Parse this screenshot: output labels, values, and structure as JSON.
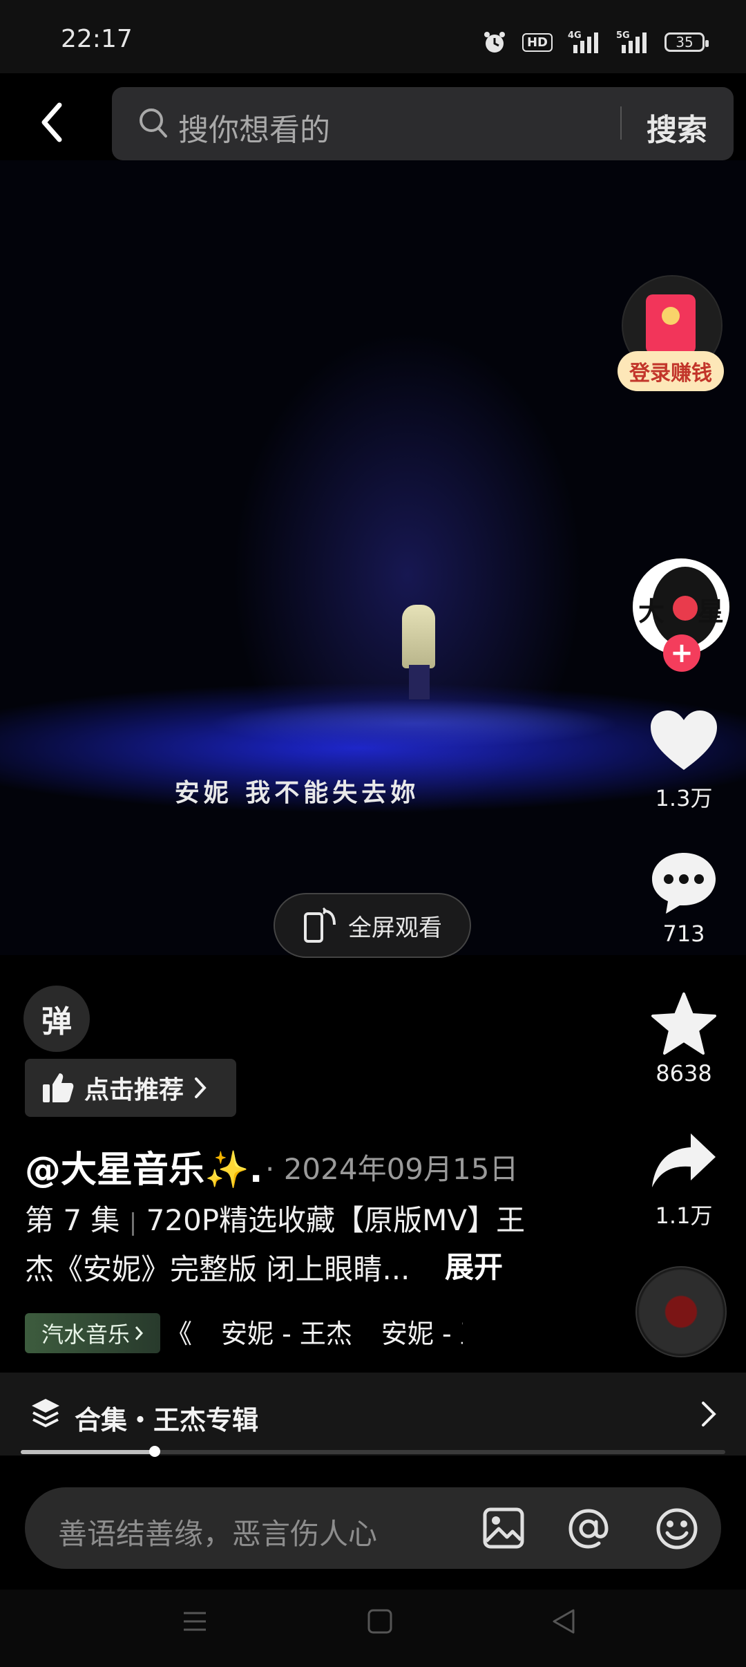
{
  "status_bar": {
    "time": "22:17",
    "battery": "35",
    "network_labels": [
      "HD",
      "4G",
      "5G"
    ]
  },
  "search": {
    "placeholder": "搜你想看的",
    "button": "搜索"
  },
  "video": {
    "subtitle": "安妮  我不能失去妳",
    "fullscreen_label": "全屏观看"
  },
  "right_rail": {
    "login_earn": "登录赚钱",
    "avatar_text": [
      "大",
      "星"
    ],
    "likes": "1.3万",
    "comments": "713",
    "favorites": "8638",
    "shares": "1.1万"
  },
  "info": {
    "danmu_label": "弹",
    "recommend_label": "点击推荐",
    "author": "@大星音乐✨.",
    "date": "· 2024年09月15日",
    "episode": "第 7 集",
    "desc_line1": "720P精选收藏【原版MV】王",
    "desc_line2": "杰《安妮》完整版 闭上眼睛...",
    "expand": "展开",
    "music_tag": "汽水音乐",
    "music_marquee": [
      "《",
      "安妮 - 王杰",
      "安妮 - 王"
    ]
  },
  "collection": {
    "label": "合集・王杰专辑",
    "progress": 0.19
  },
  "comment": {
    "placeholder": "善语结善缘，恶言伤人心"
  },
  "colors": {
    "accent": "#f43d5c",
    "login_bg": "#fde7b8",
    "music_tag": "#3d5c3e"
  }
}
